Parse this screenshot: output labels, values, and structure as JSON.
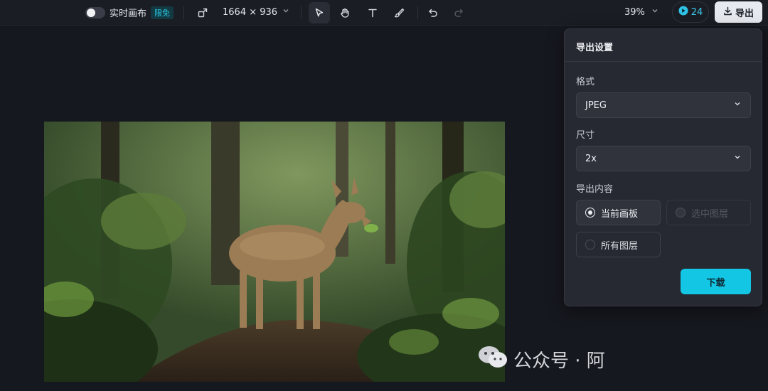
{
  "toolbar": {
    "live_canvas_label": "实时画布",
    "free_badge": "限免",
    "canvas_size": "1664 × 936",
    "zoom": "39%",
    "credits": "24",
    "export_label": "导出"
  },
  "export_panel": {
    "title": "导出设置",
    "format_label": "格式",
    "format_value": "JPEG",
    "size_label": "尺寸",
    "size_value": "2x",
    "content_label": "导出内容",
    "options": [
      {
        "label": "当前画板",
        "state": "selected"
      },
      {
        "label": "选中图层",
        "state": "disabled"
      },
      {
        "label": "所有图层",
        "state": "normal"
      }
    ],
    "download_label": "下载"
  },
  "watermark": {
    "text": "公众号 · 阿"
  },
  "colors": {
    "accent": "#12c6e4",
    "panel_bg": "#262931",
    "canvas_bg": "#16181f"
  }
}
